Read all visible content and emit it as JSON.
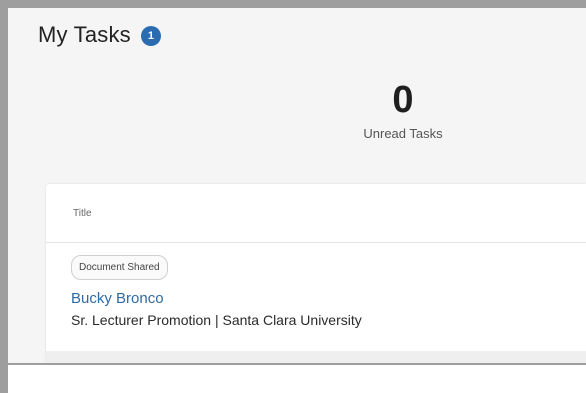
{
  "header": {
    "title": "My Tasks",
    "badge_count": "1"
  },
  "stats": {
    "unread_count": "0",
    "unread_label": "Unread Tasks"
  },
  "table": {
    "columns": [
      "Title"
    ],
    "rows": [
      {
        "tag": "Document Shared",
        "name": "Bucky Bronco",
        "subtitle": "Sr. Lecturer Promotion | Santa Clara University"
      }
    ]
  },
  "colors": {
    "badge": "#2b6cb0",
    "link": "#2f6aa3",
    "frame": "#9e9e9e"
  }
}
